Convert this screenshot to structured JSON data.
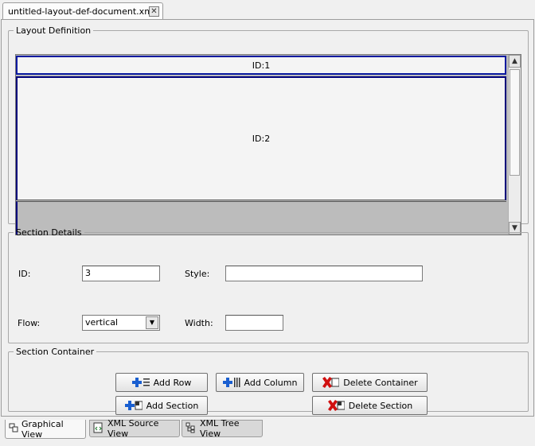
{
  "document_tab": {
    "title": "untitled-layout-def-document.xml*",
    "close_icon": "close-icon"
  },
  "layout_definition": {
    "legend": "Layout Definition",
    "rows": [
      {
        "label": "ID:1"
      },
      {
        "label": "ID:2"
      }
    ]
  },
  "section_details": {
    "legend": "Section Details",
    "id_label": "ID:",
    "id_value": "3",
    "style_label": "Style:",
    "style_value": "",
    "flow_label": "Flow:",
    "flow_value": "vertical",
    "width_label": "Width:",
    "width_value": ""
  },
  "section_container": {
    "legend": "Section Container",
    "add_row": "Add Row",
    "add_column": "Add Column",
    "delete_container": "Delete Container",
    "add_section": "Add Section",
    "delete_section": "Delete Section"
  },
  "view_tabs": [
    {
      "label": "Graphical View",
      "active": true
    },
    {
      "label": "XML Source View",
      "active": false
    },
    {
      "label": "XML Tree View",
      "active": false
    }
  ],
  "colors": {
    "selection_border": "#0a1aa0",
    "add_icon": "#1a5fd0",
    "delete_icon": "#d01010"
  }
}
